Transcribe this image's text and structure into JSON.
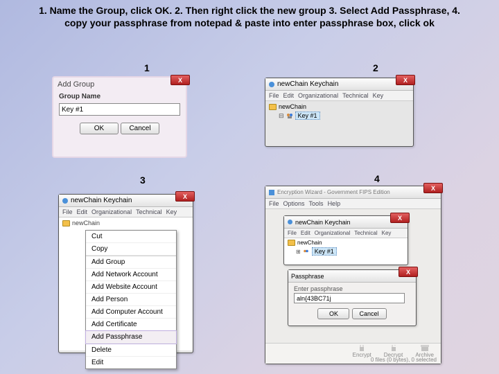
{
  "instructions": "1. Name the Group, click OK. 2. Then right click the new group 3. Select Add Passphrase, 4. copy your passphrase from notepad & paste into enter passphrase box, click ok",
  "steps": {
    "s1": "1",
    "s2": "2",
    "s3": "3",
    "s4": "4"
  },
  "panel1": {
    "title": "Add Group",
    "close": "X",
    "label": "Group Name",
    "value": "Key #1",
    "ok": "OK",
    "cancel": "Cancel"
  },
  "panel2": {
    "title": "newChain Keychain",
    "close": "X",
    "menu": {
      "file": "File",
      "edit": "Edit",
      "org": "Organizational",
      "tech": "Technical",
      "key": "Key"
    },
    "root": "newChain",
    "item": "Key #1"
  },
  "panel3": {
    "title": "newChain Keychain",
    "close": "X",
    "menu": {
      "file": "File",
      "edit": "Edit",
      "org": "Organizational",
      "tech": "Technical",
      "key": "Key"
    },
    "root": "newChain",
    "context": {
      "cut": "Cut",
      "copy": "Copy",
      "addGroup": "Add Group",
      "addNetwork": "Add Network Account",
      "addWebsite": "Add Website Account",
      "addPerson": "Add Person",
      "addComputer": "Add Computer Account",
      "addCert": "Add Certificate",
      "addPass": "Add Passphrase",
      "delete": "Delete",
      "edit": "Edit"
    }
  },
  "panel4": {
    "outerTitle": "Encryption Wizard - Government FIPS Edition",
    "outerMenu": {
      "file": "File",
      "options": "Options",
      "tools": "Tools",
      "help": "Help"
    },
    "close": "X",
    "keychain": {
      "title": "newChain Keychain",
      "menu": {
        "file": "File",
        "edit": "Edit",
        "org": "Organizational",
        "tech": "Technical",
        "key": "Key"
      },
      "root": "newChain",
      "item": "Key #1"
    },
    "passDialog": {
      "title": "Passphrase",
      "label": "Enter passphrase",
      "value": "aln{43BC71j",
      "ok": "OK",
      "cancel": "Cancel"
    },
    "status": {
      "encrypt": "Encrypt",
      "decrypt": "Decrypt",
      "archive": "Archive",
      "text": "0 files (0 bytes), 0 selected"
    }
  }
}
